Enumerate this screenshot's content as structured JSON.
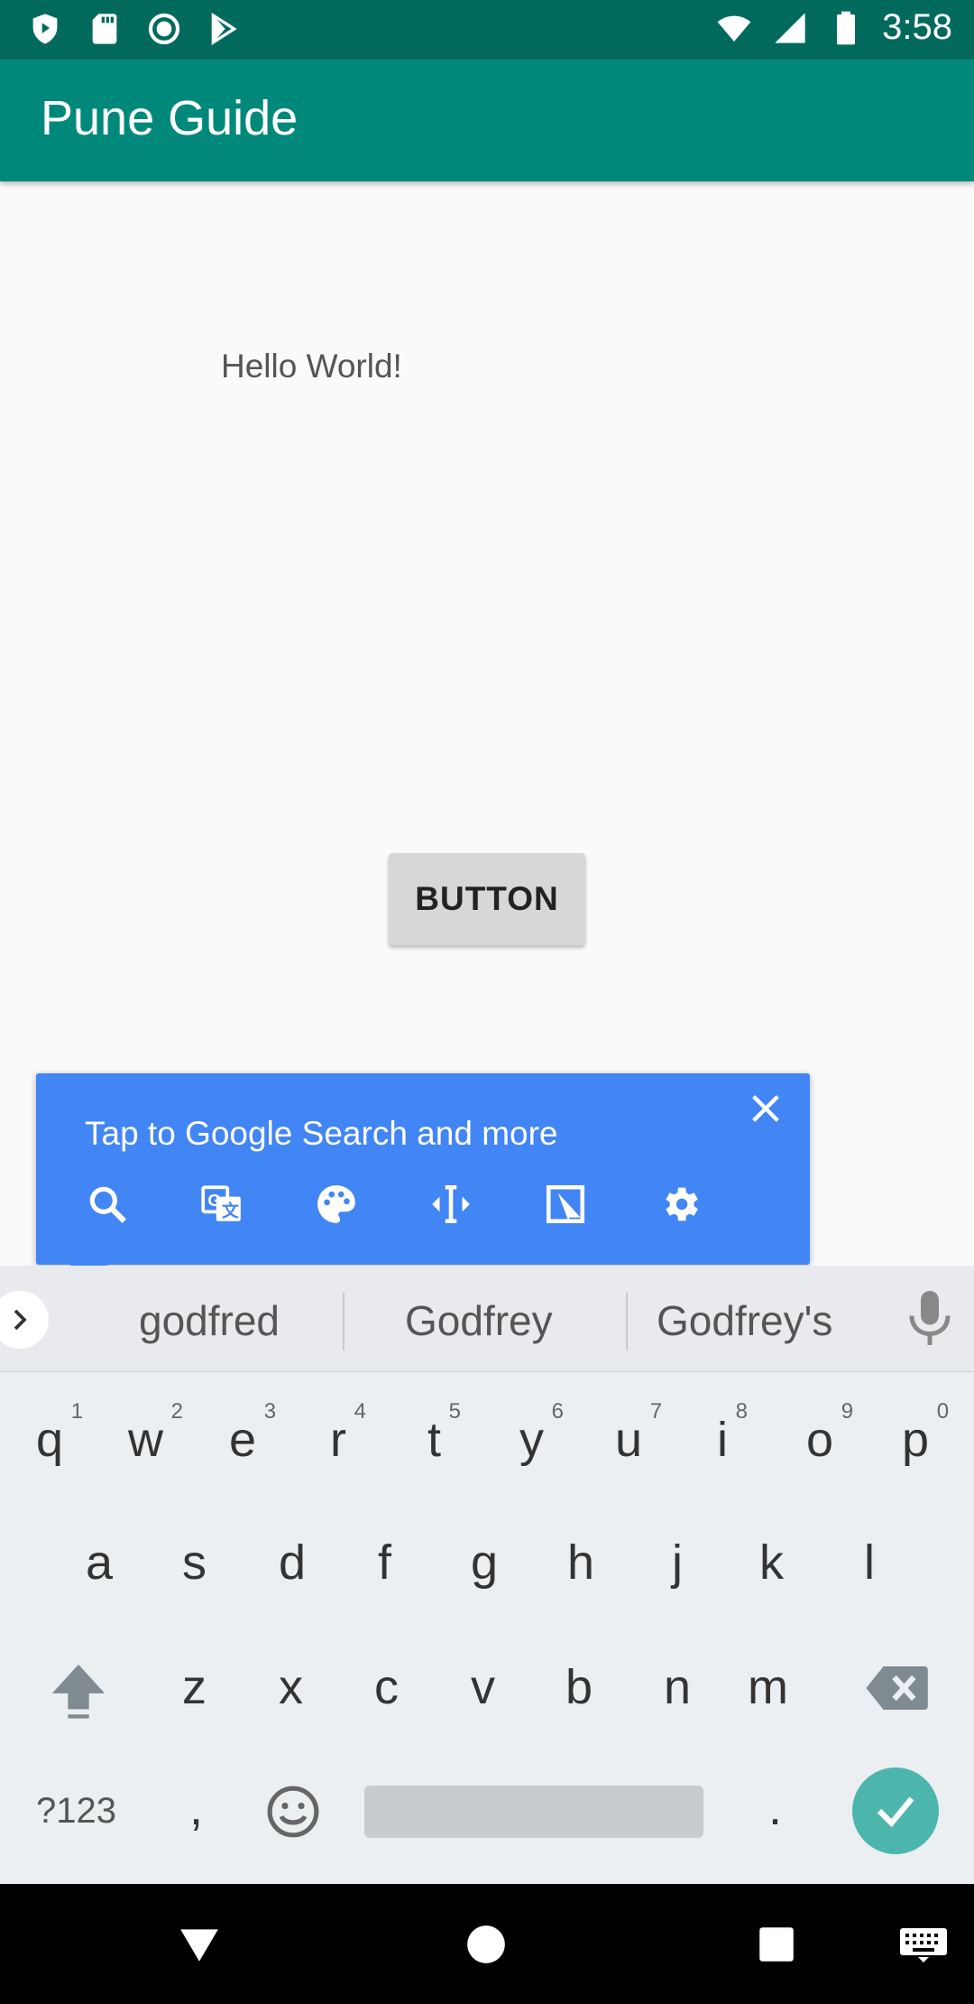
{
  "status_bar": {
    "time": "3:58",
    "left_icons": [
      "shield-play-icon",
      "sd-card-icon",
      "record-icon",
      "play-store-icon"
    ],
    "right_icons": [
      "wifi-icon",
      "cell-signal-icon",
      "battery-icon"
    ]
  },
  "app_bar": {
    "title": "Pune Guide"
  },
  "content": {
    "hello_text": "Hello World!",
    "button_label": "BUTTON"
  },
  "search_popup": {
    "text": "Tap to Google Search and more",
    "icons": [
      "search-icon",
      "translate-icon",
      "palette-icon",
      "text-cursor-icon",
      "screenshot-icon",
      "settings-icon"
    ],
    "color": "#4285f4"
  },
  "keyboard": {
    "suggestions": [
      "godfred",
      "Godfrey",
      "Godfrey's"
    ],
    "row1": [
      {
        "k": "q",
        "n": "1"
      },
      {
        "k": "w",
        "n": "2"
      },
      {
        "k": "e",
        "n": "3"
      },
      {
        "k": "r",
        "n": "4"
      },
      {
        "k": "t",
        "n": "5"
      },
      {
        "k": "y",
        "n": "6"
      },
      {
        "k": "u",
        "n": "7"
      },
      {
        "k": "i",
        "n": "8"
      },
      {
        "k": "o",
        "n": "9"
      },
      {
        "k": "p",
        "n": "0"
      }
    ],
    "row2": [
      "a",
      "s",
      "d",
      "f",
      "g",
      "h",
      "j",
      "k",
      "l"
    ],
    "row3": [
      "z",
      "x",
      "c",
      "v",
      "b",
      "n",
      "m"
    ],
    "symbols_label": "?123",
    "comma": ",",
    "period": ".",
    "enter_color": "#4db6ac"
  },
  "colors": {
    "status_bar": "#016a5c",
    "app_bar": "#00897b"
  }
}
